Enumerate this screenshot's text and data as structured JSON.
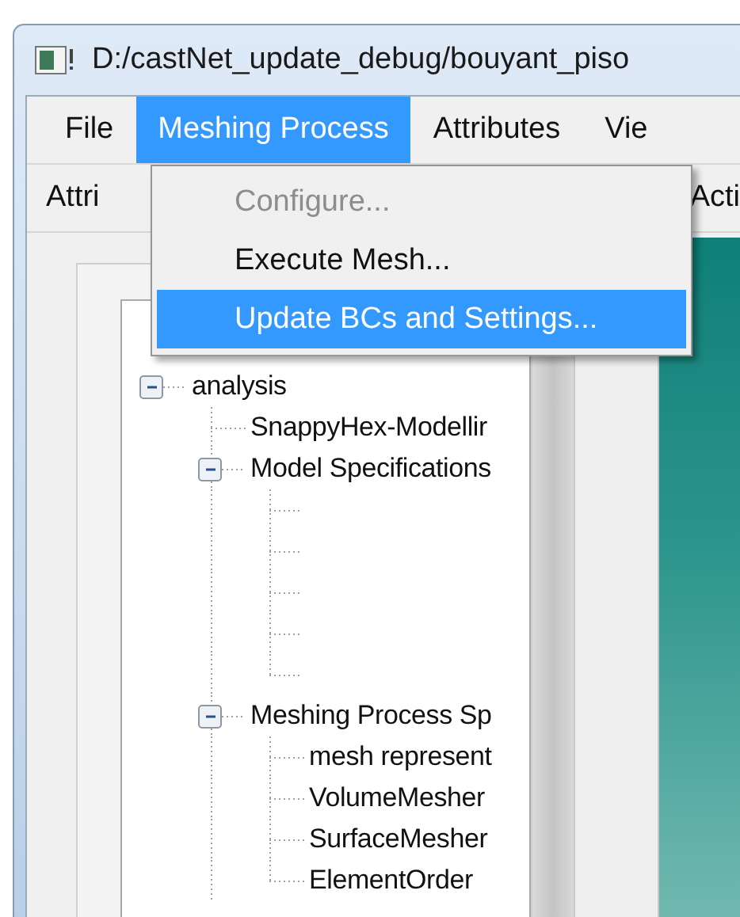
{
  "window": {
    "title": "D:/castNet_update_debug/bouyant_piso"
  },
  "menu_bar": [
    {
      "label": "File",
      "selected": false
    },
    {
      "label": "Meshing Process",
      "selected": true
    },
    {
      "label": "Attributes",
      "selected": false
    },
    {
      "label": "Vie",
      "selected": false
    }
  ],
  "toolbar": [
    "Attri",
    "Acti"
  ],
  "dropdown": [
    {
      "label": "Configure...",
      "disabled": true,
      "selected": false
    },
    {
      "label": "Execute Mesh...",
      "disabled": false,
      "selected": false
    },
    {
      "label": "Update BCs and Settings...",
      "disabled": false,
      "selected": true
    }
  ],
  "tree": [
    {
      "label": "analysis",
      "expanded": true,
      "children": [
        {
          "label": "SnappyHex-Modellir"
        },
        {
          "label": "Model Specifications",
          "expanded": true,
          "children": [
            {
              "kind": "blank"
            },
            {
              "kind": "blank"
            },
            {
              "kind": "blank"
            },
            {
              "kind": "blank"
            },
            {
              "kind": "blank"
            }
          ]
        },
        {
          "label": "Meshing Process Sp",
          "expanded": true,
          "children": [
            {
              "label": "mesh represent"
            },
            {
              "label": "VolumeMesher"
            },
            {
              "label": "SurfaceMesher"
            },
            {
              "label": "ElementOrder"
            }
          ]
        }
      ]
    }
  ]
}
